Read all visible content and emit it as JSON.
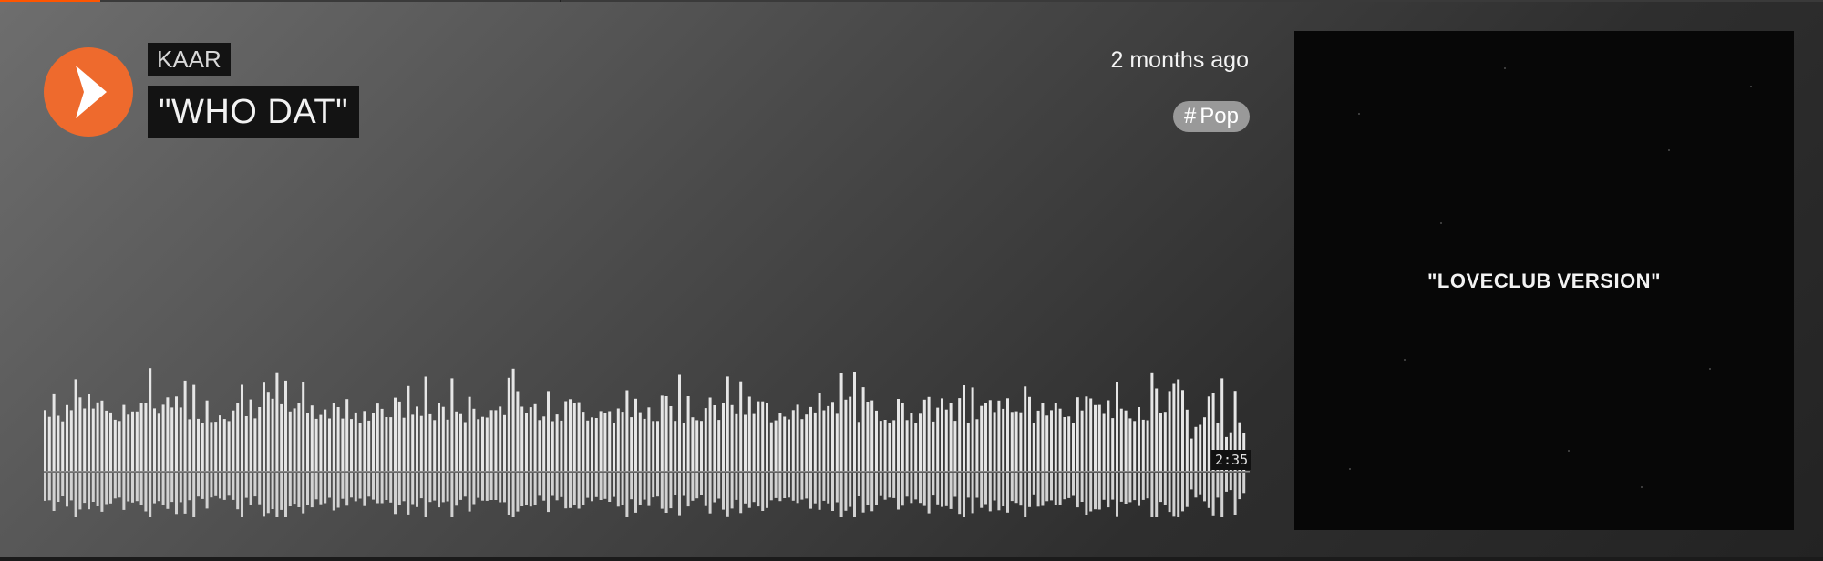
{
  "track": {
    "artist": "KAAR",
    "title": "\"WHO DAT\"",
    "posted": "2 months ago",
    "genre_hash": "#",
    "genre": "Pop",
    "duration": "2:35"
  },
  "artwork": {
    "caption": "\"LOVECLUB VERSION\""
  },
  "player": {
    "progress_fraction": 0.055
  },
  "colors": {
    "accent": "#ee6a2d",
    "progress": "#ff5500",
    "waveform_bar": "#e6e6e6",
    "tag_background": "#131313",
    "genre_pill": "#999999"
  },
  "icons": {
    "play": "play-icon"
  }
}
